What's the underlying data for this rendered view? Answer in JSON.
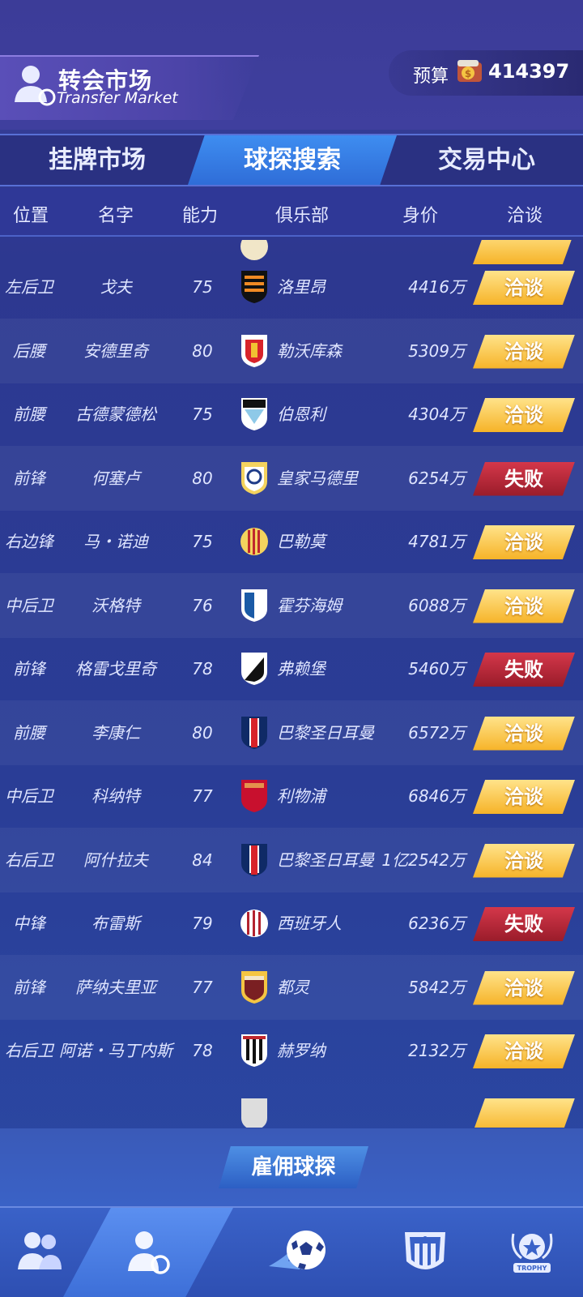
{
  "header": {
    "title_cn": "转会市场",
    "title_en": "Transfer Market",
    "budget_label": "预算",
    "budget_value": "414397"
  },
  "tabs": [
    {
      "label": "挂牌市场",
      "active": false
    },
    {
      "label": "球探搜索",
      "active": true
    },
    {
      "label": "交易中心",
      "active": false
    }
  ],
  "columns": [
    "位置",
    "名字",
    "能力",
    "俱乐部",
    "身价",
    "洽谈"
  ],
  "rows": [
    {
      "position": "左后卫",
      "name": "戈夫",
      "ability": "75",
      "club": "洛里昂",
      "value": "4416万",
      "action": "洽谈",
      "status": "talk",
      "crest": "lorient-crest-icon"
    },
    {
      "position": "后腰",
      "name": "安德里奇",
      "ability": "80",
      "club": "勒沃库森",
      "value": "5309万",
      "action": "洽谈",
      "status": "talk",
      "crest": "leverkusen-crest-icon"
    },
    {
      "position": "前腰",
      "name": "古德蒙德松",
      "ability": "75",
      "club": "伯恩利",
      "value": "4304万",
      "action": "洽谈",
      "status": "talk",
      "crest": "burnley-crest-icon"
    },
    {
      "position": "前锋",
      "name": "何塞卢",
      "ability": "80",
      "club": "皇家马德里",
      "value": "6254万",
      "action": "失败",
      "status": "fail",
      "crest": "real-madrid-crest-icon"
    },
    {
      "position": "右边锋",
      "name": "马・诺迪",
      "ability": "75",
      "club": "巴勒莫",
      "value": "4781万",
      "action": "洽谈",
      "status": "talk",
      "crest": "palermo-crest-icon"
    },
    {
      "position": "中后卫",
      "name": "沃格特",
      "ability": "76",
      "club": "霍芬海姆",
      "value": "6088万",
      "action": "洽谈",
      "status": "talk",
      "crest": "hoffenheim-crest-icon"
    },
    {
      "position": "前锋",
      "name": "格雷戈里奇",
      "ability": "78",
      "club": "弗赖堡",
      "value": "5460万",
      "action": "失败",
      "status": "fail",
      "crest": "freiburg-crest-icon"
    },
    {
      "position": "前腰",
      "name": "李康仁",
      "ability": "80",
      "club": "巴黎圣日耳曼",
      "value": "6572万",
      "action": "洽谈",
      "status": "talk",
      "crest": "psg-crest-icon"
    },
    {
      "position": "中后卫",
      "name": "科纳特",
      "ability": "77",
      "club": "利物浦",
      "value": "6846万",
      "action": "洽谈",
      "status": "talk",
      "crest": "liverpool-crest-icon"
    },
    {
      "position": "右后卫",
      "name": "阿什拉夫",
      "ability": "84",
      "club": "巴黎圣日耳曼",
      "value": "1亿2542万",
      "action": "洽谈",
      "status": "talk",
      "crest": "psg-crest-icon"
    },
    {
      "position": "中锋",
      "name": "布雷斯",
      "ability": "79",
      "club": "西班牙人",
      "value": "6236万",
      "action": "失败",
      "status": "fail",
      "crest": "espanyol-crest-icon"
    },
    {
      "position": "前锋",
      "name": "萨纳夫里亚",
      "ability": "77",
      "club": "都灵",
      "value": "5842万",
      "action": "洽谈",
      "status": "talk",
      "crest": "torino-crest-icon"
    },
    {
      "position": "右后卫",
      "name": "阿诺・马丁内斯",
      "ability": "78",
      "club": "赫罗纳",
      "value": "2132万",
      "action": "洽谈",
      "status": "talk",
      "crest": "girona-crest-icon"
    }
  ],
  "hire_button": "雇佣球探",
  "nav": [
    {
      "name": "squad-icon",
      "active": false
    },
    {
      "name": "transfer-icon",
      "active": true
    },
    {
      "name": "football-icon",
      "active": false
    },
    {
      "name": "club-badge-icon",
      "active": false
    },
    {
      "name": "trophy-icon",
      "active": false,
      "label": "TROPHY"
    }
  ],
  "colors": {
    "talk_button": "#f6b328",
    "fail_button": "#b3232f",
    "active_tab": "#3e8df0"
  }
}
